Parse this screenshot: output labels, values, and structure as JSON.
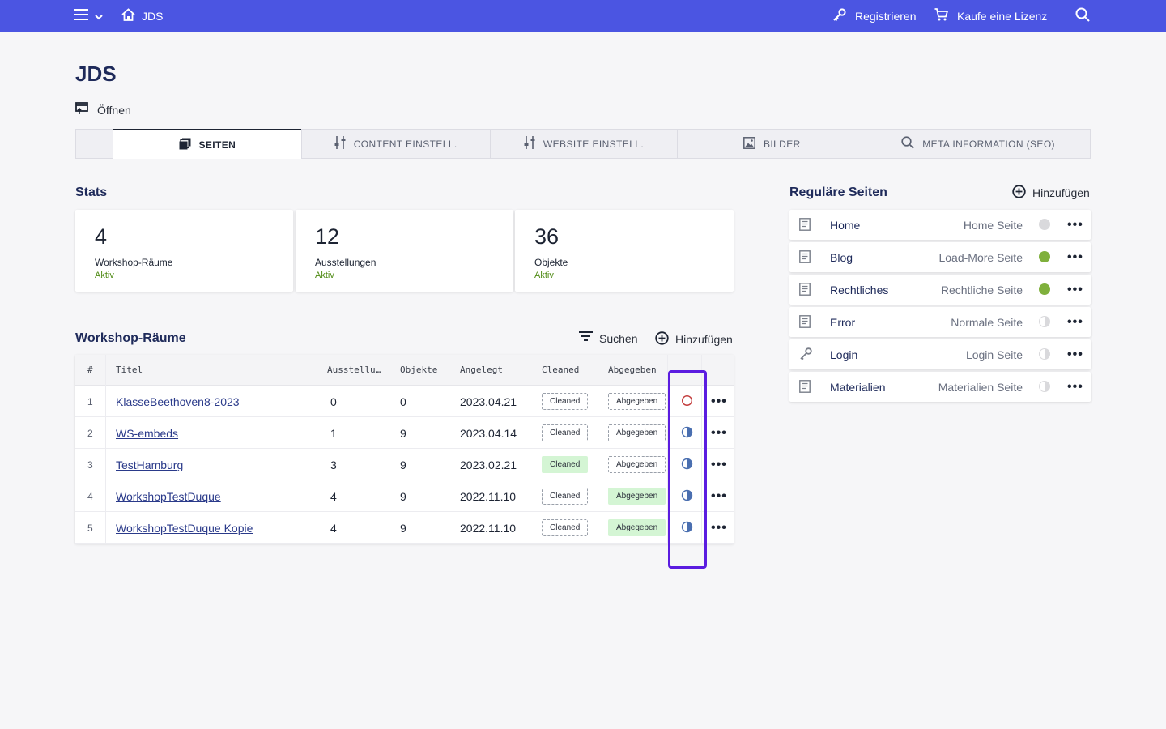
{
  "topbar": {
    "home_label": "JDS",
    "register_label": "Registrieren",
    "license_label": "Kaufe eine Lizenz"
  },
  "page": {
    "title": "JDS",
    "open_label": "Öffnen"
  },
  "tabs": [
    {
      "label": "SEITEN",
      "icon": "pages-icon",
      "active": true
    },
    {
      "label": "CONTENT EINSTELL.",
      "icon": "sliders-icon",
      "active": false
    },
    {
      "label": "WEBSITE EINSTELL.",
      "icon": "sliders-icon",
      "active": false
    },
    {
      "label": "BILDER",
      "icon": "image-icon",
      "active": false
    },
    {
      "label": "META INFORMATION (SEO)",
      "icon": "search-icon",
      "active": false
    }
  ],
  "stats": {
    "title": "Stats",
    "cards": [
      {
        "value": "4",
        "label": "Workshop-Räume",
        "status": "Aktiv"
      },
      {
        "value": "12",
        "label": "Ausstellungen",
        "status": "Aktiv"
      },
      {
        "value": "36",
        "label": "Objekte",
        "status": "Aktiv"
      }
    ]
  },
  "workshops": {
    "title": "Workshop-Räume",
    "search_label": "Suchen",
    "add_label": "Hinzufügen",
    "columns": [
      "#",
      "Titel",
      "Ausstellu…",
      "Objekte",
      "Angelegt",
      "Cleaned",
      "Abgegeben"
    ],
    "rows": [
      {
        "idx": "1",
        "title": "KlasseBeethoven8-2023",
        "ausstellungen": "0",
        "objekte": "0",
        "angelegt": "2023.04.21",
        "cleaned": "Cleaned",
        "cleaned_on": false,
        "abgegeben": "Abgegeben",
        "abgegeben_on": false,
        "status": "empty-circle-icon"
      },
      {
        "idx": "2",
        "title": "WS-embeds",
        "ausstellungen": "1",
        "objekte": "9",
        "angelegt": "2023.04.14",
        "cleaned": "Cleaned",
        "cleaned_on": false,
        "abgegeben": "Abgegeben",
        "abgegeben_on": false,
        "status": "half-circle-icon"
      },
      {
        "idx": "3",
        "title": "TestHamburg",
        "ausstellungen": "3",
        "objekte": "9",
        "angelegt": "2023.02.21",
        "cleaned": "Cleaned",
        "cleaned_on": true,
        "abgegeben": "Abgegeben",
        "abgegeben_on": false,
        "status": "half-circle-icon"
      },
      {
        "idx": "4",
        "title": "WorkshopTestDuque",
        "ausstellungen": "4",
        "objekte": "9",
        "angelegt": "2022.11.10",
        "cleaned": "Cleaned",
        "cleaned_on": false,
        "abgegeben": "Abgegeben",
        "abgegeben_on": true,
        "status": "half-circle-icon"
      },
      {
        "idx": "5",
        "title": "WorkshopTestDuque Kopie",
        "ausstellungen": "4",
        "objekte": "9",
        "angelegt": "2022.11.10",
        "cleaned": "Cleaned",
        "cleaned_on": false,
        "abgegeben": "Abgegeben",
        "abgegeben_on": true,
        "status": "half-circle-icon"
      }
    ]
  },
  "regular_pages": {
    "title": "Reguläre Seiten",
    "add_label": "Hinzufügen",
    "items": [
      {
        "name": "Home",
        "type": "Home Seite",
        "icon": "document-icon",
        "status": "inactive",
        "status_color": "#d9d9dc"
      },
      {
        "name": "Blog",
        "type": "Load-More Seite",
        "icon": "document-icon",
        "status": "active",
        "status_color": "#7fb03c"
      },
      {
        "name": "Rechtliches",
        "type": "Rechtliche Seite",
        "icon": "document-icon",
        "status": "active",
        "status_color": "#7fb03c"
      },
      {
        "name": "Error",
        "type": "Normale Seite",
        "icon": "document-icon",
        "status": "partial",
        "status_color": "#d9d9dc"
      },
      {
        "name": "Login",
        "type": "Login Seite",
        "icon": "key-icon",
        "status": "partial",
        "status_color": "#d9d9dc"
      },
      {
        "name": "Materialien",
        "type": "Materialien Seite",
        "icon": "document-icon",
        "status": "partial",
        "status_color": "#d9d9dc"
      }
    ]
  },
  "colors": {
    "topbar": "#4b55e2",
    "accent_text": "#1e2a5a",
    "status_active": "#4e8a12",
    "highlight": "#5b1ce0"
  }
}
